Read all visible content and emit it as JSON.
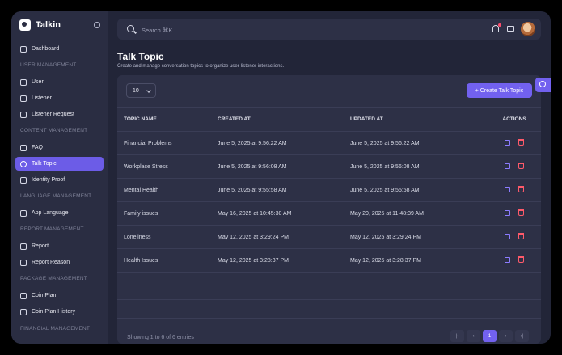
{
  "brand": {
    "name": "Talkin"
  },
  "sidebar": {
    "items": [
      {
        "label": "Dashboard"
      },
      {
        "label": "User"
      },
      {
        "label": "Listener"
      },
      {
        "label": "Listener Request"
      },
      {
        "label": "FAQ"
      },
      {
        "label": "Talk Topic",
        "active": true
      },
      {
        "label": "Identity Proof"
      },
      {
        "label": "App Language"
      },
      {
        "label": "Report"
      },
      {
        "label": "Report Reason"
      },
      {
        "label": "Coin Plan"
      },
      {
        "label": "Coin Plan History"
      }
    ],
    "sections": [
      "USER MANAGEMENT",
      "CONTENT MANAGEMENT",
      "LANGUAGE MANAGEMENT",
      "REPORT MANAGEMENT",
      "PACKAGE MANAGEMENT",
      "FINANCIAL MANAGEMENT"
    ]
  },
  "search": {
    "placeholder": "Search ⌘K"
  },
  "page": {
    "title": "Talk Topic",
    "subtitle": "Create and manage conversation topics to organize user-listener interactions."
  },
  "controls": {
    "page_size": "10",
    "create_label": "+ Create Talk Topic"
  },
  "table": {
    "headers": [
      "TOPIC NAME",
      "CREATED AT",
      "UPDATED AT",
      "ACTIONS"
    ],
    "rows": [
      [
        "Financial Problems",
        "June 5, 2025 at 9:56:22 AM",
        "June 5, 2025 at 9:56:22 AM"
      ],
      [
        "Workplace Stress",
        "June 5, 2025 at 9:56:08 AM",
        "June 5, 2025 at 9:56:08 AM"
      ],
      [
        "Mental Health",
        "June 5, 2025 at 9:55:58 AM",
        "June 5, 2025 at 9:55:58 AM"
      ],
      [
        "Family issues",
        "May 16, 2025 at 10:45:30 AM",
        "May 20, 2025 at 11:48:39 AM"
      ],
      [
        "Loneliness",
        "May 12, 2025 at 3:29:24 PM",
        "May 12, 2025 at 3:29:24 PM"
      ],
      [
        "Health Issues",
        "May 12, 2025 at 3:28:37 PM",
        "May 12, 2025 at 3:28:37 PM"
      ]
    ]
  },
  "footer": {
    "info": "Showing 1 to 6 of 6 entries",
    "pager": [
      "|‹",
      "‹",
      "1",
      "›",
      "›|"
    ]
  },
  "colors": {
    "accent": "#7261ef",
    "delete": "#ff5a6a"
  }
}
